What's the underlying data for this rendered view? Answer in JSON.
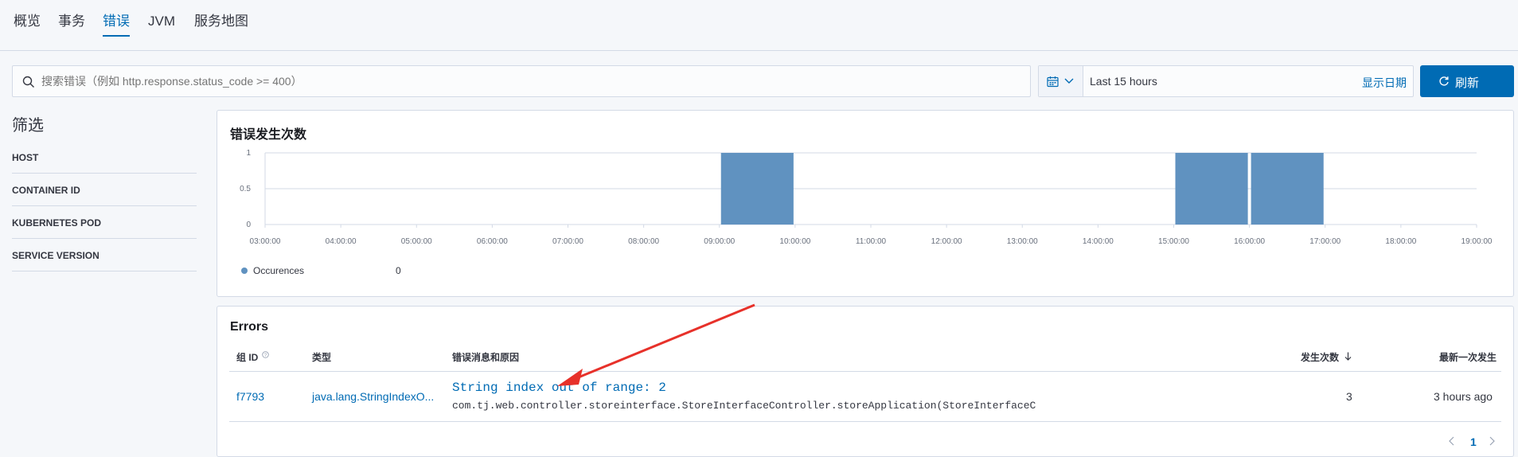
{
  "tabs": [
    {
      "label": "概览"
    },
    {
      "label": "事务"
    },
    {
      "label": "错误"
    },
    {
      "label": "JVM"
    },
    {
      "label": "服务地图"
    }
  ],
  "search": {
    "placeholder": "搜索错误（例如 http.response.status_code >= 400）"
  },
  "datepicker": {
    "range": "Last 15 hours",
    "show_dates": "显示日期"
  },
  "refresh": {
    "label": "刷新"
  },
  "filters": {
    "title": "筛选",
    "items": [
      "HOST",
      "CONTAINER ID",
      "KUBERNETES POD",
      "SERVICE VERSION"
    ]
  },
  "chart_panel": {
    "title": "错误发生次数",
    "legend": {
      "name": "Occurences",
      "value": "0",
      "color": "#6092c0"
    }
  },
  "chart_data": {
    "type": "bar",
    "title": "错误发生次数",
    "x": [
      "03:00:00",
      "04:00:00",
      "05:00:00",
      "06:00:00",
      "07:00:00",
      "08:00:00",
      "09:00:00",
      "10:00:00",
      "11:00:00",
      "12:00:00",
      "13:00:00",
      "14:00:00",
      "15:00:00",
      "16:00:00",
      "17:00:00",
      "18:00:00",
      "19:00:00"
    ],
    "yticks": [
      "0",
      "0.5",
      "1"
    ],
    "ylim": [
      0,
      1
    ],
    "series": [
      {
        "name": "Occurences",
        "color": "#6092c0",
        "bars": [
          {
            "start": "09:00:00",
            "end": "10:00:00",
            "value": 1
          },
          {
            "start": "15:00:00",
            "end": "16:00:00",
            "value": 1
          },
          {
            "start": "16:00:00",
            "end": "17:00:00",
            "value": 1
          }
        ]
      }
    ],
    "grid": true,
    "legend": "bottom-left"
  },
  "errors_panel": {
    "title": "Errors",
    "columns": {
      "group_id": "组 ID",
      "type": "类型",
      "message": "错误消息和原因",
      "occurrences": "发生次数",
      "latest": "最新一次发生"
    },
    "rows": [
      {
        "group_id": "f7793",
        "type": "java.lang.StringIndexO...",
        "message": "String index out of range: 2",
        "culprit": "com.tj.web.controller.storeinterface.StoreInterfaceController.storeApplication(StoreInterfaceC",
        "occurrences": "3",
        "latest": "3 hours ago"
      }
    ],
    "pagination": {
      "current": "1"
    }
  },
  "annotation": {
    "color": "#e7312a"
  }
}
